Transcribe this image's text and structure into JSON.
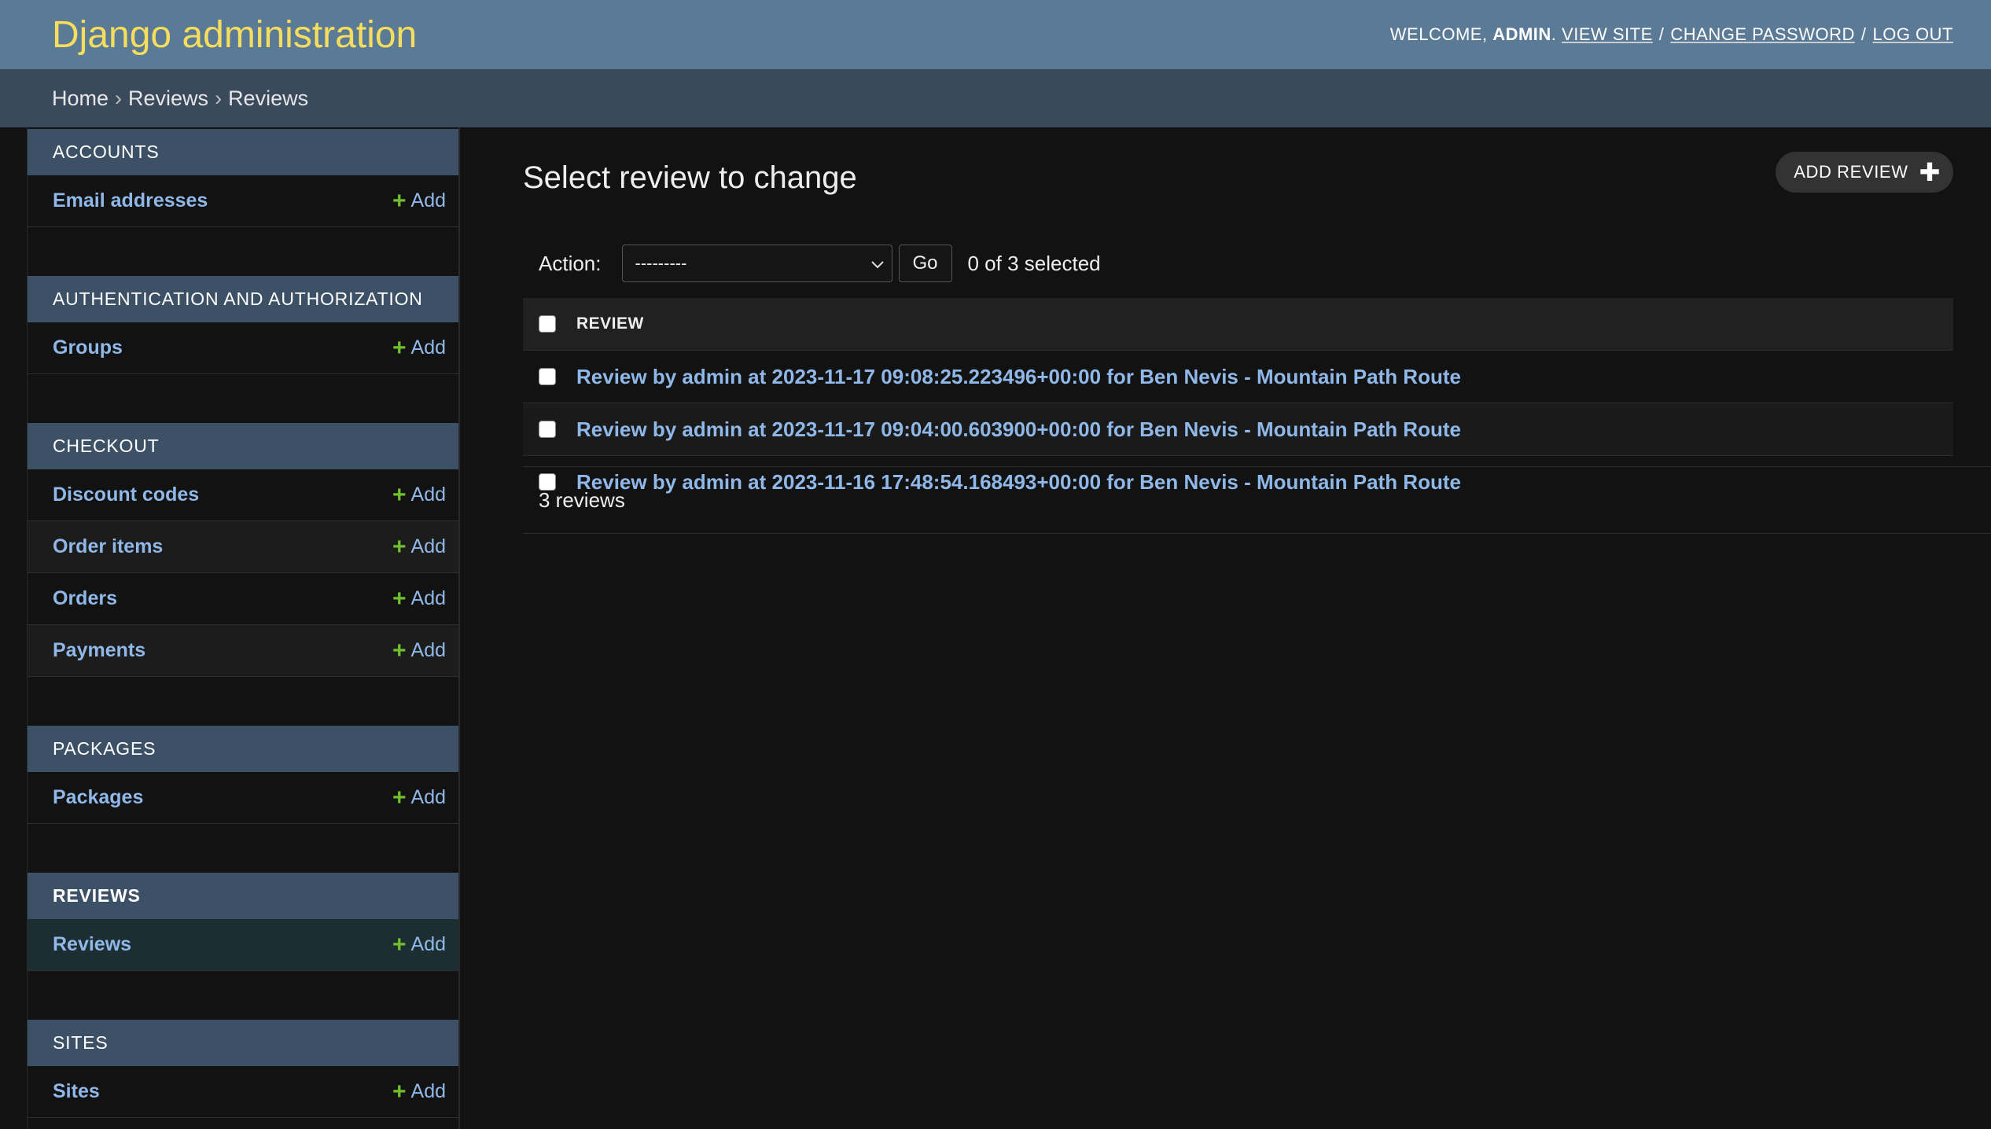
{
  "header": {
    "branding": "Django administration",
    "welcome": "WELCOME,",
    "username": "ADMIN",
    "view_site": "VIEW SITE",
    "change_password": "CHANGE PASSWORD",
    "log_out": "LOG OUT"
  },
  "breadcrumbs": {
    "items": [
      "Home",
      "Reviews",
      "Reviews"
    ]
  },
  "sidebar": {
    "add_label": "Add",
    "modules": [
      {
        "caption": "Accounts",
        "models": [
          "Email addresses"
        ]
      },
      {
        "caption": "Authentication and Authorization",
        "models": [
          "Groups"
        ]
      },
      {
        "caption": "Checkout",
        "models": [
          "Discount codes",
          "Order items",
          "Orders",
          "Payments"
        ]
      },
      {
        "caption": "Packages",
        "models": [
          "Packages"
        ]
      },
      {
        "caption": "Reviews",
        "models": [
          "Reviews"
        ]
      },
      {
        "caption": "Sites",
        "models": [
          "Sites"
        ]
      }
    ]
  },
  "content": {
    "title": "Select review to change",
    "add_button": "ADD REVIEW",
    "action_label": "Action:",
    "action_select_value": "---------",
    "go_label": "Go",
    "selected_count": "0 of 3 selected",
    "column_header": "REVIEW",
    "rows": [
      "Review by admin at 2023-11-17 09:08:25.223496+00:00 for Ben Nevis - Mountain Path Route",
      "Review by admin at 2023-11-17 09:04:00.603900+00:00 for Ben Nevis - Mountain Path Route",
      "Review by admin at 2023-11-16 17:48:54.168493+00:00 for Ben Nevis - Mountain Path Route"
    ],
    "paginator": "3 reviews"
  },
  "colors": {
    "header_bg": "#5b7a96",
    "branding": "#f5dd5d",
    "breadcrumbs_bg": "#3a4a5c",
    "module_caption_bg": "#3d5166",
    "link": "#8fb8e8",
    "add_icon": "#70bf2b",
    "page_bg": "#121212"
  }
}
